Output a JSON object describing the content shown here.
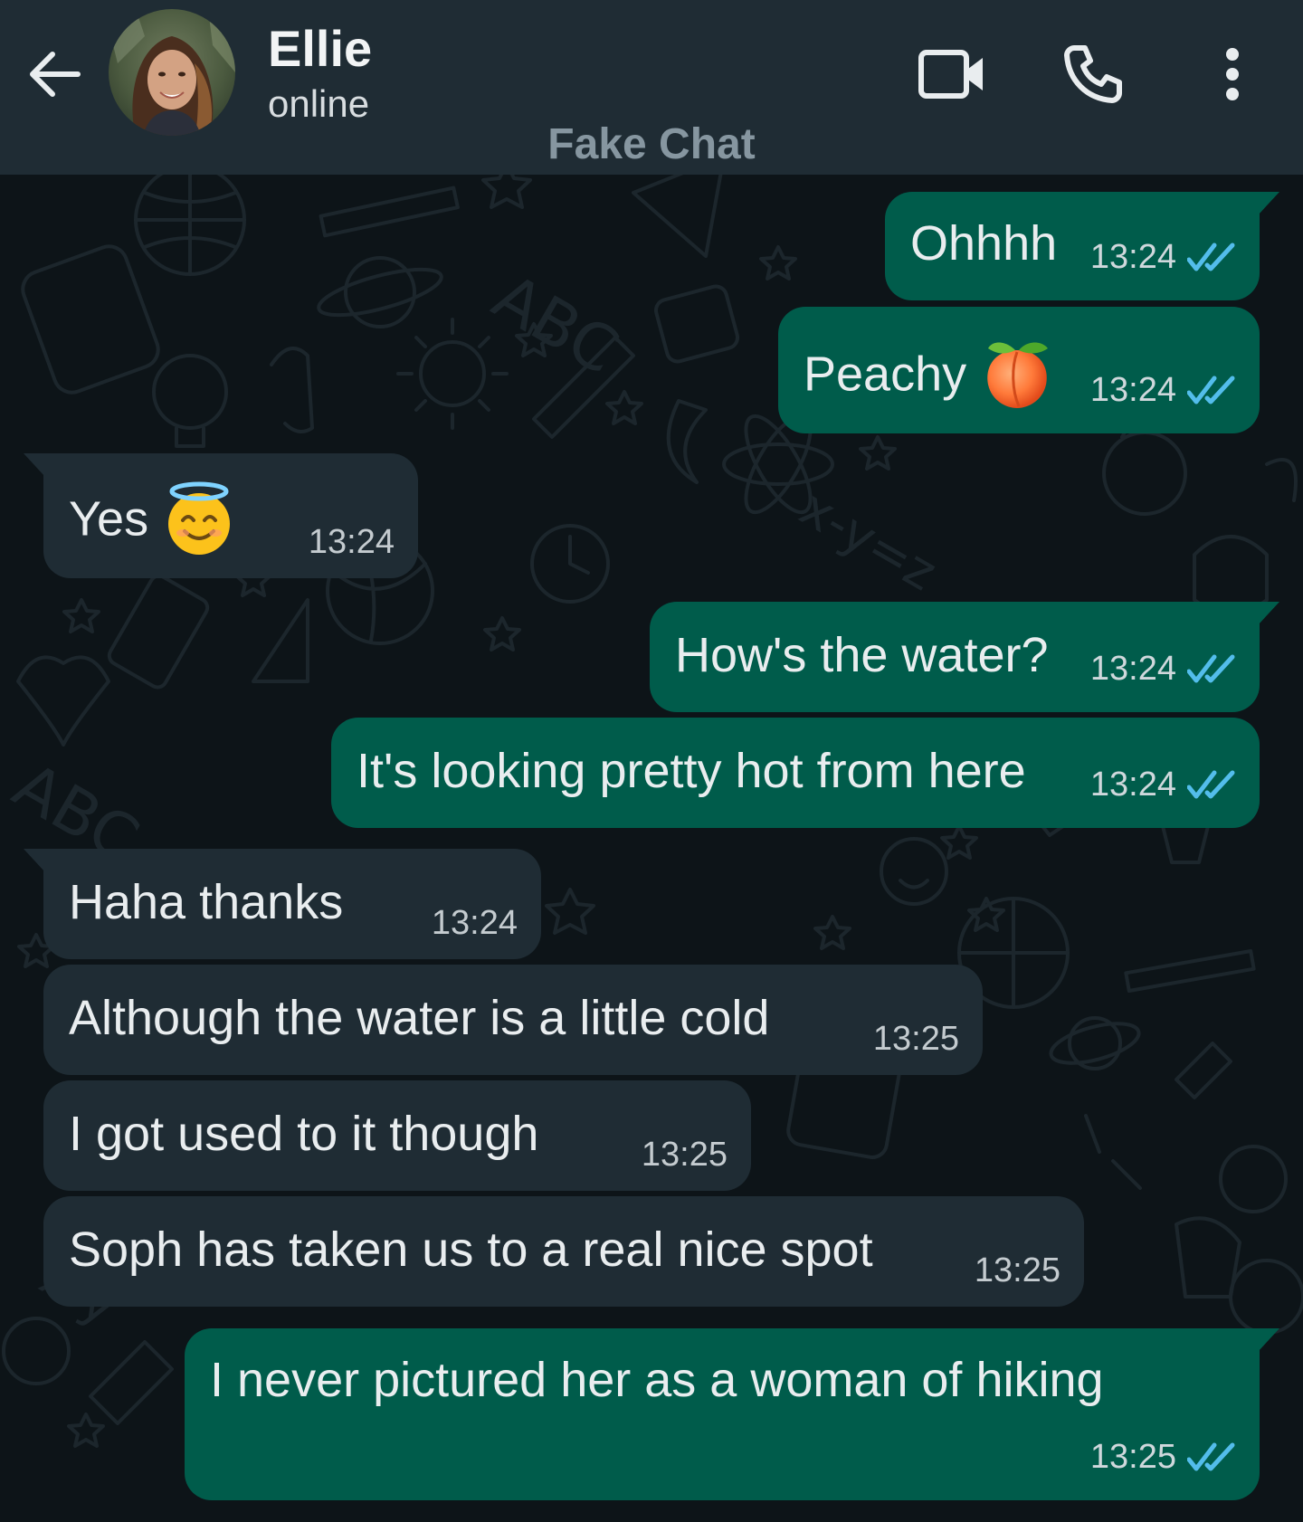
{
  "header": {
    "contact_name": "Ellie",
    "contact_status": "online",
    "watermark": "Fake Chat",
    "icons": {
      "back": "arrow-left-icon",
      "video_call": "video-camera-icon",
      "voice_call": "phone-icon",
      "menu": "more-vertical-icon"
    }
  },
  "colors": {
    "header_bg": "#1f2c34",
    "chat_bg": "#0d1418",
    "outgoing_bubble": "#005c4b",
    "incoming_bubble": "#1f2c34",
    "read_ticks": "#53bdeb"
  },
  "messages": [
    {
      "direction": "out",
      "text": "Ohhhh",
      "time": "13:24",
      "status": "read"
    },
    {
      "direction": "out",
      "text": "Peachy",
      "emoji": "peach",
      "time": "13:24",
      "status": "read"
    },
    {
      "direction": "in",
      "text": "Yes",
      "emoji": "smiling-face-with-halo",
      "time": "13:24"
    },
    {
      "direction": "out",
      "text": "How's the water?",
      "time": "13:24",
      "status": "read"
    },
    {
      "direction": "out",
      "text": "It's looking pretty hot from here",
      "time": "13:24",
      "status": "read"
    },
    {
      "direction": "in",
      "text": "Haha thanks",
      "time": "13:24"
    },
    {
      "direction": "in",
      "text": "Although the water is a little cold",
      "time": "13:25"
    },
    {
      "direction": "in",
      "text": "I got used to it though",
      "time": "13:25"
    },
    {
      "direction": "in",
      "text": "Soph has taken us to a real nice spot",
      "time": "13:25"
    },
    {
      "direction": "out",
      "text": "I never pictured her as a woman of hiking",
      "time": "13:25",
      "status": "read"
    }
  ]
}
